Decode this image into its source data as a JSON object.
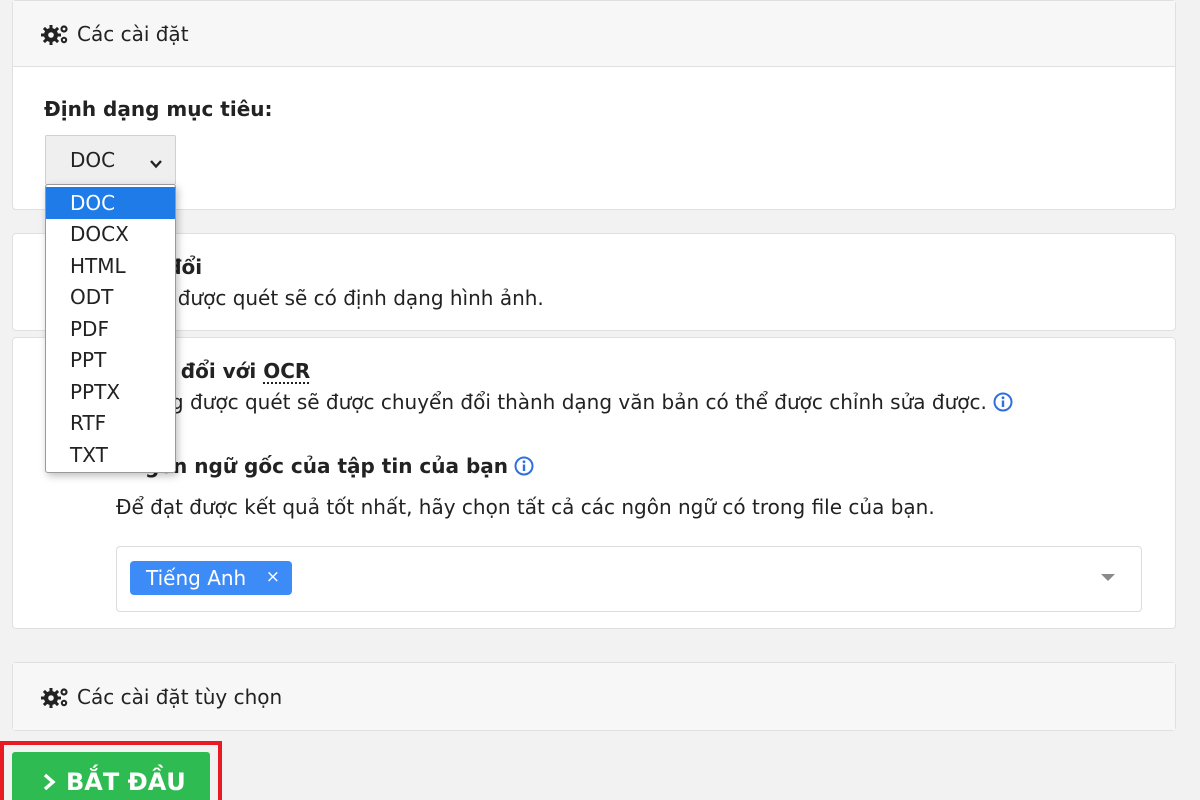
{
  "settings": {
    "header_label": "Các cài đặt",
    "target_format_label": "Định dạng mục tiêu:",
    "target_format_value": "DOC"
  },
  "format_dropdown": {
    "options": [
      "DOC",
      "DOCX",
      "HTML",
      "ODT",
      "PDF",
      "PPT",
      "PPTX",
      "RTF",
      "TXT"
    ],
    "selected": "DOC"
  },
  "conversion": {
    "title_visible": "n đổi",
    "desc_visible": "ng được quét sẽ có định dạng hình ảnh."
  },
  "ocr_conversion": {
    "title_visible_part1": "ển đổi với ",
    "title_ocr": "OCR",
    "desc_visible": "ang được quét sẽ được chuyển đổi thành dạng văn bản có thể được chỉnh sửa được.",
    "source_lang_label_visible": "gôn ngữ gốc của tập tin của bạn",
    "source_lang_help": "Để đạt được kết quả tốt nhất, hãy chọn tất cả các ngôn ngữ có trong file của bạn.",
    "selected_language": "Tiếng Anh",
    "remove_symbol": "×"
  },
  "optional_settings": {
    "header_label": "Các cài đặt tùy chọn"
  },
  "start_button": {
    "label": "BẮT ĐẦU"
  },
  "colors": {
    "accent_blue": "#3d8bf7",
    "dropdown_selected": "#1e7be8",
    "start_green": "#2ebc52",
    "highlight_red": "#e81b25",
    "info_icon_blue": "#2f6fe0"
  }
}
